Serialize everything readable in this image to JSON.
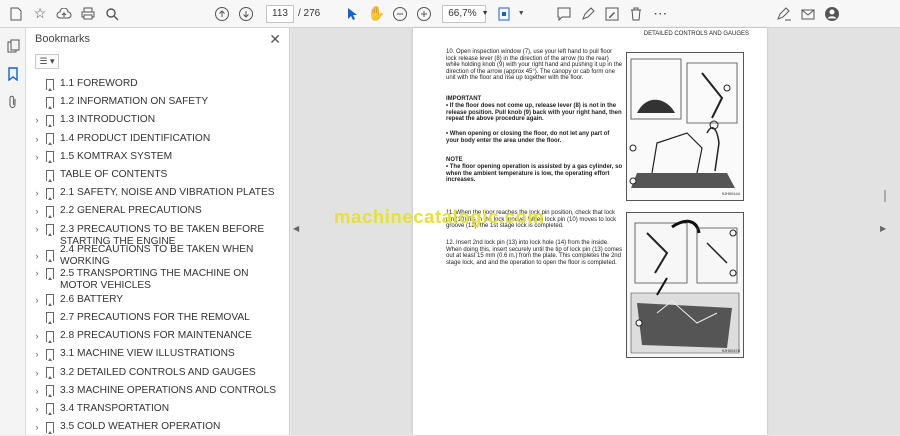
{
  "toolbar": {
    "current_page": "113",
    "total_pages": "/ 276",
    "zoom": "66,7%"
  },
  "panel": {
    "title": "Bookmarks",
    "options_icon": "list-options-icon"
  },
  "bookmarks": [
    {
      "label": "1.1 FOREWORD",
      "expandable": false
    },
    {
      "label": "1.2 INFORMATION ON SAFETY",
      "expandable": false
    },
    {
      "label": "1.3 INTRODUCTION",
      "expandable": true
    },
    {
      "label": "1.4 PRODUCT IDENTIFICATION",
      "expandable": true
    },
    {
      "label": "1.5 KOMTRAX SYSTEM",
      "expandable": true
    },
    {
      "label": "TABLE OF CONTENTS",
      "expandable": false
    },
    {
      "label": "2.1 SAFETY, NOISE AND VIBRATION PLATES",
      "expandable": true
    },
    {
      "label": "2.2 GENERAL PRECAUTIONS",
      "expandable": true
    },
    {
      "label": "2.3 PRECAUTIONS TO BE TAKEN BEFORE STARTING THE ENGINE",
      "expandable": true
    },
    {
      "label": "2.4 PRECAUTIONS TO BE TAKEN WHEN WORKING",
      "expandable": true
    },
    {
      "label": "2.5 TRANSPORTING THE MACHINE ON MOTOR VEHICLES",
      "expandable": true
    },
    {
      "label": "2.6 BATTERY",
      "expandable": true
    },
    {
      "label": "2.7 PRECAUTIONS FOR THE REMOVAL",
      "expandable": false
    },
    {
      "label": "2.8 PRECAUTIONS FOR MAINTENANCE",
      "expandable": true
    },
    {
      "label": "3.1 MACHINE VIEW ILLUSTRATIONS",
      "expandable": true
    },
    {
      "label": "3.2 DETAILED CONTROLS AND GAUGES",
      "expandable": true
    },
    {
      "label": "3.3 MACHINE OPERATIONS AND CONTROLS",
      "expandable": true
    },
    {
      "label": "3.4 TRANSPORTATION",
      "expandable": true
    },
    {
      "label": "3.5 COLD WEATHER OPERATION",
      "expandable": true
    }
  ],
  "document": {
    "header": "DETAILED CONTROLS AND GAUGES",
    "step10": "10. Open inspection window (7), use your left hand to pull floor lock release lever (8) in the direction of the arrow (to the rear) while holding knob (9) with your right hand and pushing it up in the direction of the arrow (approx 45°). The canopy or cab form one unit with the floor and rise up together with the floor.",
    "important_title": "IMPORTANT",
    "important_1": "• If the floor does not come up, release lever (8) is not in the release position. Pull knob (9) back with your right hand, then repeat the above procedure again.",
    "important_2": "• When opening or closing the floor, do not let any part of your body enter the area under the floor.",
    "note_title": "NOTE",
    "note_1": "• The floor opening operation is assisted by a gas cylinder, so when the ambient temperature is low, the operating effort increases.",
    "step11": "11. When the floor reaches the lock pin position, check that lock pin (10) fits in the lock groove. When lock pin (10) moves to lock groove (12), the 1st stage lock is completed.",
    "step12": "12. Insert 2nd lock pin (13) into lock hole (14) from the inside. When doing this, insert securely until the tip of lock pin (13) comes out at least 15 mm (0.6 in.) from the plate. This completes the 2nd stage lock, and and the operation to open the floor is completed.",
    "fig1_code": "9JH00144",
    "fig2_code": "9JH00478",
    "watermark": "machinecatalogic.com"
  }
}
